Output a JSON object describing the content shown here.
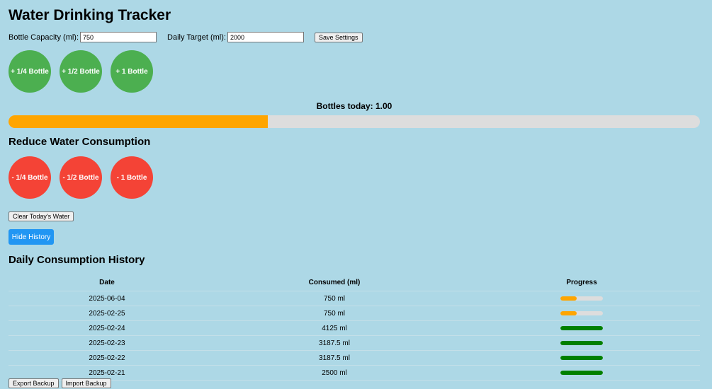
{
  "app": {
    "title": "Water Drinking Tracker"
  },
  "settings": {
    "capacity_label": "Bottle Capacity (ml):",
    "capacity_value": "750",
    "target_label": "Daily Target (ml):",
    "target_value": "2000",
    "save_label": "Save Settings"
  },
  "add_buttons": [
    "+ 1/4 Bottle",
    "+ 1/2 Bottle",
    "+ 1 Bottle"
  ],
  "status": {
    "bottles_text": "Bottles today: 1.00",
    "progress_fraction": 0.375,
    "progress_color": "#FFA500"
  },
  "reduce": {
    "title": "Reduce Water Consumption",
    "buttons": [
      "- 1/4 Bottle",
      "- 1/2 Bottle",
      "- 1 Bottle"
    ]
  },
  "clear_label": "Clear Today's Water",
  "hide_history_label": "Hide History",
  "history": {
    "title": "Daily Consumption History",
    "headers": [
      "Date",
      "Consumed (ml)",
      "Progress"
    ],
    "rows": [
      {
        "date": "2025-06-04",
        "consumed": "750 ml",
        "progress": 0.375,
        "color": "#FFA500"
      },
      {
        "date": "2025-02-25",
        "consumed": "750 ml",
        "progress": 0.375,
        "color": "#FFA500"
      },
      {
        "date": "2025-02-24",
        "consumed": "4125 ml",
        "progress": 1,
        "color": "#008000"
      },
      {
        "date": "2025-02-23",
        "consumed": "3187.5 ml",
        "progress": 1,
        "color": "#008000"
      },
      {
        "date": "2025-02-22",
        "consumed": "3187.5 ml",
        "progress": 1,
        "color": "#008000"
      },
      {
        "date": "2025-02-21",
        "consumed": "2500 ml",
        "progress": 1,
        "color": "#008000"
      }
    ]
  },
  "footer": {
    "export_label": "Export Backup",
    "import_label": "Import Backup"
  }
}
